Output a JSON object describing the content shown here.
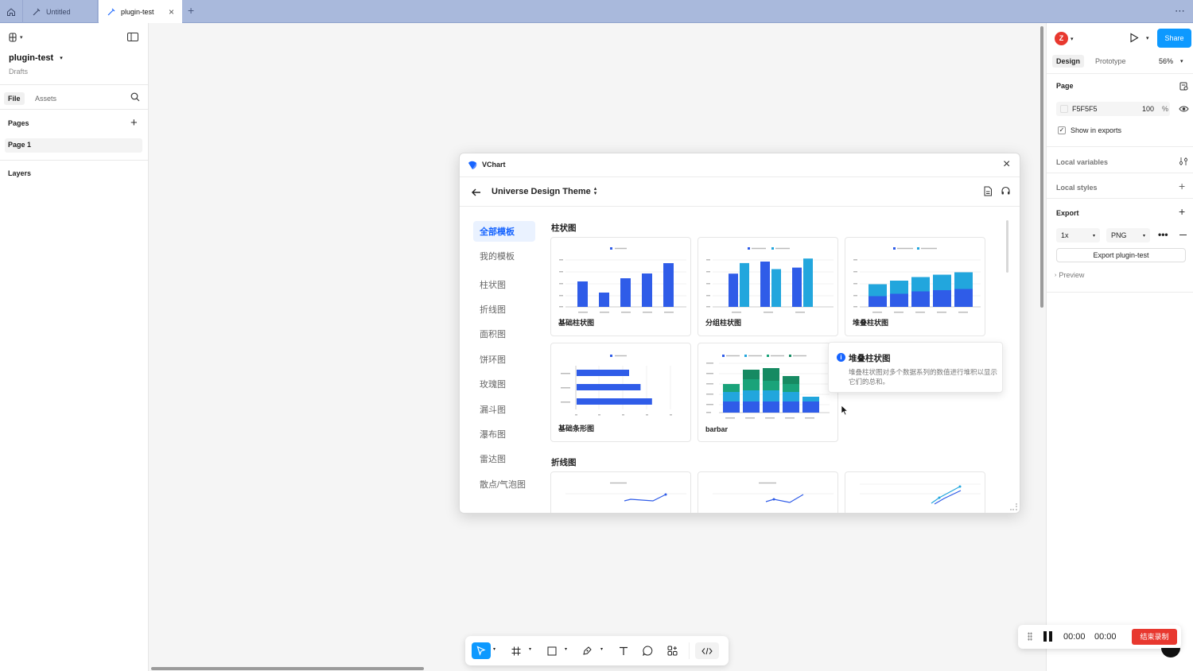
{
  "tabs": {
    "home_icon": "home-icon",
    "untitled": "Untitled",
    "active": "plugin-test",
    "add": "+",
    "more": "⋯"
  },
  "left": {
    "file_name": "plugin-test",
    "location": "Drafts",
    "tab_file": "File",
    "tab_assets": "Assets",
    "pages_title": "Pages",
    "page1": "Page 1",
    "layers_title": "Layers"
  },
  "right": {
    "avatar_letter": "Z",
    "share": "Share",
    "tab_design": "Design",
    "tab_prototype": "Prototype",
    "zoom": "56%",
    "page_title": "Page",
    "bg_color": "F5F5F5",
    "bg_opacity": "100",
    "percent": "%",
    "show_in_exports": "Show in exports",
    "local_variables": "Local variables",
    "local_styles": "Local styles",
    "export_title": "Export",
    "export_scale": "1x",
    "export_format": "PNG",
    "export_button": "Export plugin-test",
    "preview": "Preview"
  },
  "plugin": {
    "app_name": "VChart",
    "theme_title": "Universe Design Theme",
    "nav": [
      "全部模板",
      "我的模板",
      "柱状图",
      "折线图",
      "面积图",
      "饼环图",
      "玫瑰图",
      "漏斗图",
      "瀑布图",
      "雷达图",
      "散点/气泡图"
    ],
    "section_bar": "柱状图",
    "section_line": "折线图",
    "cards": {
      "basic_bar": "基础柱状图",
      "group_bar": "分组柱状图",
      "stack_bar": "堆叠柱状图",
      "basic_hbar": "基础条形图",
      "barbar": "barbar"
    },
    "tooltip": {
      "title": "堆叠柱状图",
      "desc": "堆叠柱状图对多个数据系列的数值进行堆积以显示它们的总和。"
    }
  },
  "recorder": {
    "time1": "00:00",
    "time2": "00:00",
    "end_button": "结束录制"
  },
  "colors": {
    "accent": "#1664ff",
    "bar_blue": "#2f5ce8",
    "bar_cyan": "#22a6dd",
    "bar_green": "#1aa37a",
    "share_bg": "#0d99ff",
    "record_red": "#e8382f"
  },
  "chart_data": [
    {
      "type": "bar",
      "title": "基础柱状图",
      "values": [
        32,
        18,
        36,
        42,
        55
      ]
    },
    {
      "type": "bar",
      "title": "分组柱状图",
      "series": [
        {
          "values": [
            22,
            30,
            26
          ]
        },
        {
          "values": [
            29,
            25,
            32
          ]
        }
      ]
    },
    {
      "type": "bar",
      "title": "堆叠柱状图",
      "series": [
        {
          "values": [
            18,
            22,
            26,
            28,
            30
          ]
        },
        {
          "values": [
            20,
            22,
            24,
            26,
            28
          ]
        }
      ]
    },
    {
      "type": "bar",
      "title": "基础条形图",
      "values": [
        20,
        23,
        26
      ]
    },
    {
      "type": "bar",
      "title": "barbar"
    }
  ]
}
